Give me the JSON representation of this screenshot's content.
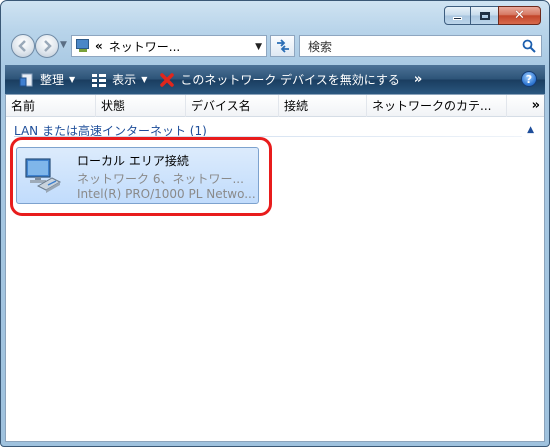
{
  "window": {
    "buttons": {
      "minimize": "–",
      "maximize": "□",
      "close": "✕"
    }
  },
  "nav": {
    "back_icon": "back-arrow-icon",
    "forward_icon": "forward-arrow-icon",
    "address_chevron": "«",
    "address_text": "ネットワー...",
    "search_placeholder": "検索"
  },
  "command_bar": {
    "organize": "整理",
    "view": "表示",
    "disable": "このネットワーク デバイスを無効にする",
    "more": "»",
    "help": "?"
  },
  "columns": [
    "名前",
    "状態",
    "デバイス名",
    "接続",
    "ネットワークのカテ..."
  ],
  "columns_more": "»",
  "group": {
    "title": "LAN または高速インターネット (1)"
  },
  "item": {
    "name": "ローカル エリア接続",
    "status": "ネットワーク 6、ネットワー...",
    "device": "Intel(R) PRO/1000 PL Netwo..."
  },
  "colors": {
    "highlight": "#e81c1c",
    "selection": "#c1dcfc",
    "group_text": "#1e4e9a"
  }
}
